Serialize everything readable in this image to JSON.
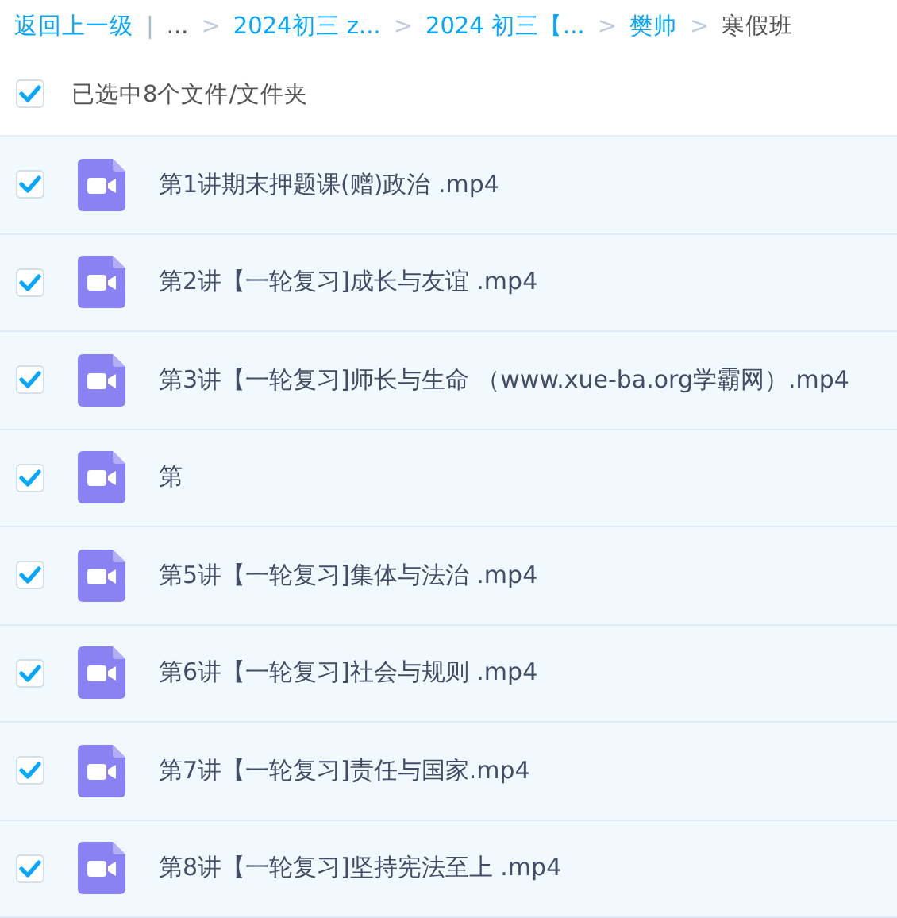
{
  "breadcrumb": [
    {
      "label": "返回上一级",
      "kind": "link"
    },
    {
      "label": "|",
      "kind": "bar"
    },
    {
      "label": "...",
      "kind": "text"
    },
    {
      "label": ">",
      "kind": "sep"
    },
    {
      "label": "2024初三 z...",
      "kind": "link"
    },
    {
      "label": ">",
      "kind": "sep"
    },
    {
      "label": "2024 初三【...",
      "kind": "link"
    },
    {
      "label": ">",
      "kind": "sep"
    },
    {
      "label": "樊帅",
      "kind": "link"
    },
    {
      "label": ">",
      "kind": "sep"
    },
    {
      "label": "寒假班",
      "kind": "current"
    }
  ],
  "select_all": {
    "label": "已选中8个文件/文件夹",
    "checked": true
  },
  "files": [
    {
      "name": "第1讲期末押题课(赠)政治 .mp4",
      "checked": true
    },
    {
      "name": "第2讲【一轮复习]成长与友谊 .mp4",
      "checked": true
    },
    {
      "name": "第3讲【一轮复习]师长与生命 （www.xue-ba.org学霸网）.mp4",
      "checked": true
    },
    {
      "name": "第",
      "checked": true
    },
    {
      "name": "第5讲【一轮复习]集体与法治 .mp4",
      "checked": true
    },
    {
      "name": "第6讲【一轮复习]社会与规则 .mp4",
      "checked": true
    },
    {
      "name": "第7讲【一轮复习]责任与国家.mp4",
      "checked": true
    },
    {
      "name": "第8讲【一轮复习]坚持宪法至上 .mp4",
      "checked": true
    }
  ]
}
